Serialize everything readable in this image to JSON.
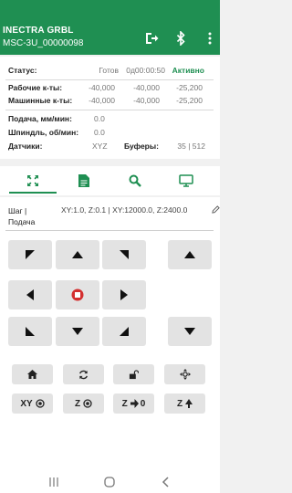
{
  "header": {
    "title": "INECTRA GRBL",
    "subtitle": "MSC-3U_00000098",
    "bg": "#1f8f52",
    "icons": [
      "exit-icon",
      "bluetooth-icon",
      "more-vert-icon"
    ]
  },
  "status": {
    "state_label": "Статус:",
    "state_value": "Готов",
    "time": "0д00:00:50",
    "connection": "Активно",
    "work_coords_label": "Рабочие к-ты:",
    "work_coords": [
      "-40,000",
      "-40,000",
      "-25,200"
    ],
    "machine_coords_label": "Машинные к-ты:",
    "machine_coords": [
      "-40,000",
      "-40,000",
      "-25,200"
    ],
    "feed_label": "Подача, мм/мин:",
    "feed_value": "0.0",
    "spindle_label": "Шпиндль, об/мин:",
    "spindle_value": "0.0",
    "sensors_label": "Датчики:",
    "sensors_value": "XYZ",
    "buffers_label": "Буферы:",
    "buffers_value": "35 | 512"
  },
  "tabs": [
    "jog-tab",
    "file-tab",
    "probe-tab",
    "console-tab"
  ],
  "jog": {
    "step_label": "Шаг | Подача",
    "step_value": "XY:1.0, Z:0.1 | XY:12000.0, Z:2400.0"
  },
  "actions": {
    "xy_zero": "XY",
    "z_zero": "Z",
    "z_move": "Z",
    "z_move_target": "0",
    "z_probe": "Z"
  },
  "colors": {
    "accent": "#1f8f52",
    "active_text": "#1f8f52",
    "stop_red": "#d32f2f"
  }
}
